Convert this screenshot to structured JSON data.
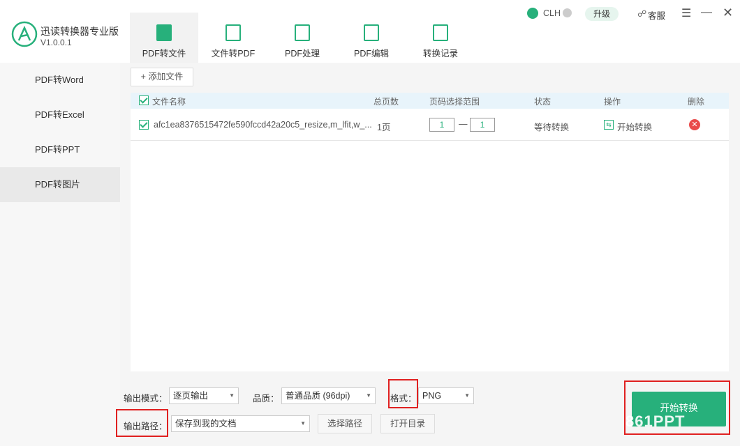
{
  "app": {
    "name": "迅读转换器专业版",
    "version": "V1.0.0.1"
  },
  "tabs": [
    {
      "label": "PDF转文件"
    },
    {
      "label": "文件转PDF"
    },
    {
      "label": "PDF处理"
    },
    {
      "label": "PDF编辑"
    },
    {
      "label": "转换记录"
    }
  ],
  "topbar": {
    "user": "CLH",
    "upgrade": "升级",
    "service": "客服",
    "menu": "☰",
    "minimize": "—"
  },
  "sidebar": {
    "items": [
      {
        "label": "PDF转Word"
      },
      {
        "label": "PDF转Excel"
      },
      {
        "label": "PDF转PPT"
      },
      {
        "label": "PDF转图片"
      }
    ]
  },
  "main": {
    "add_file": "+ 添加文件",
    "columns": [
      "文件名称",
      "总页数",
      "页码选择范围",
      "状态",
      "操作",
      "删除"
    ],
    "rows": [
      {
        "name": "afc1ea8376515472fe590fccd42a20c5_resize,m_lfit,w_...",
        "pages": "1页",
        "from": "1",
        "to": "1",
        "dash": "—",
        "status": "等待转换",
        "action": "开始转换"
      }
    ]
  },
  "options": {
    "mode_label": "输出模式：",
    "mode_value": "逐页输出",
    "quality_label": "品质：",
    "quality_value": "普通品质 (96dpi)",
    "format_label": "格式：",
    "format_value": "PNG",
    "path_label": "输出路径：",
    "path_value": "保存到我的文档",
    "choose_path": "选择路径",
    "open_dir": "打开目录",
    "start": "开始转换"
  },
  "watermark": "861PPT",
  "colors": {
    "accent": "#27b07b",
    "highlight": "#e02020",
    "delete": "#e94b4b"
  }
}
